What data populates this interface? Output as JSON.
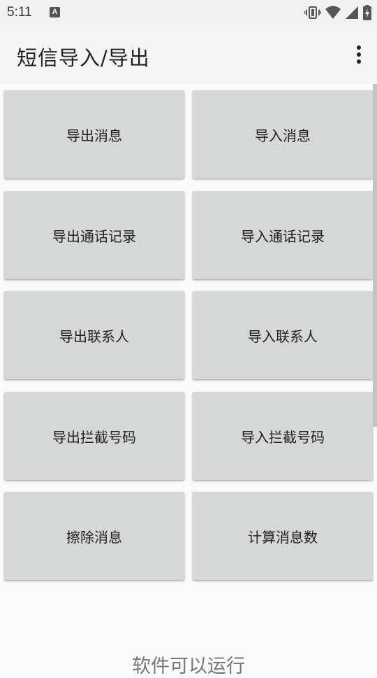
{
  "status_bar": {
    "time": "5:11",
    "notification_icon_letter": "A",
    "icons": [
      "vibrate-icon",
      "wifi-icon",
      "cell-signal-icon",
      "battery-charging-icon"
    ]
  },
  "app_bar": {
    "title": "短信导入/导出",
    "menu_icon": "more-vert-icon"
  },
  "buttons": [
    {
      "label": "导出消息"
    },
    {
      "label": "导入消息"
    },
    {
      "label": "导出通话记录"
    },
    {
      "label": "导入通话记录"
    },
    {
      "label": "导出联系人"
    },
    {
      "label": "导入联系人"
    },
    {
      "label": "导出拦截号码"
    },
    {
      "label": "导入拦截号码"
    },
    {
      "label": "擦除消息"
    },
    {
      "label": "计算消息数"
    }
  ],
  "status_message": "软件可以运行",
  "colors": {
    "status_bar_bg": "#f1f1f1",
    "app_bar_bg": "#f5f5f5",
    "button_bg": "#d6d7d7",
    "page_bg": "#fafafa"
  }
}
